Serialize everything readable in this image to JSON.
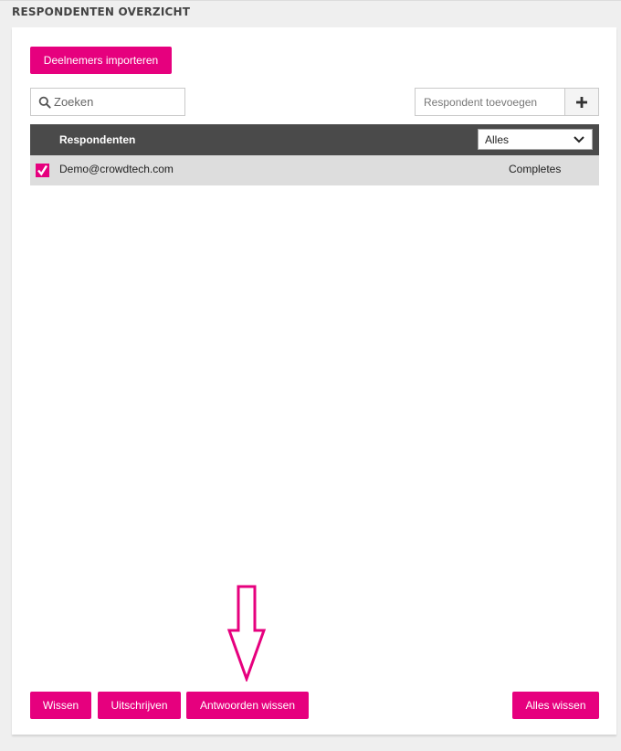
{
  "header": {
    "title": "RESPONDENTEN OVERZICHT"
  },
  "toolbar": {
    "import_label": "Deelnemers importeren"
  },
  "search": {
    "placeholder": "Zoeken"
  },
  "add_respondent": {
    "placeholder": "Respondent toevoegen",
    "button_icon": "plus-icon"
  },
  "table": {
    "header_label": "Respondenten",
    "filter": {
      "selected": "Alles"
    },
    "rows": [
      {
        "email": "Demo@crowdtech.com",
        "status": "Completes",
        "checked": true
      }
    ]
  },
  "actions": {
    "clear_label": "Wissen",
    "unsubscribe_label": "Uitschrijven",
    "clear_answers_label": "Antwoorden wissen",
    "clear_all_label": "Alles wissen"
  },
  "annotation": {
    "icon": "down-arrow-icon",
    "color": "#e6007e"
  },
  "colors": {
    "accent": "#e6007e",
    "table_header": "#4a4a4a",
    "row_bg": "#dddddd",
    "page_bg": "#efefef"
  }
}
